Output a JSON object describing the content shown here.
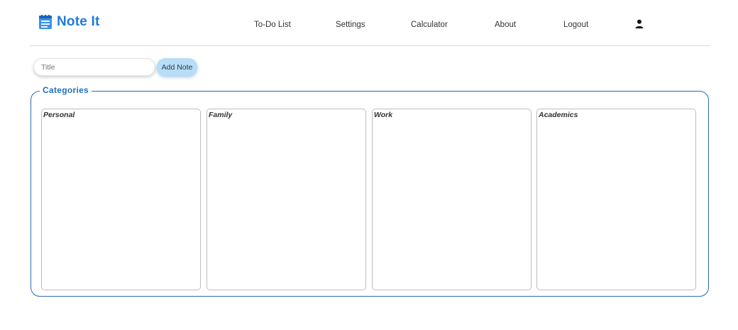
{
  "app": {
    "title": "Note It",
    "brand_icon": "notepad-icon",
    "brand_color": "#1f7bd8"
  },
  "nav": {
    "items": [
      {
        "label": "To-Do List"
      },
      {
        "label": "Settings"
      },
      {
        "label": "Calculator"
      },
      {
        "label": "About"
      },
      {
        "label": "Logout"
      }
    ],
    "user_icon": "user-icon"
  },
  "add_note": {
    "title_placeholder": "Title",
    "title_value": "",
    "button_label": "Add Note",
    "button_color": "#b8ddf6"
  },
  "categories": {
    "legend": "Categories",
    "border_color": "#2b6cb0",
    "items": [
      {
        "label": "Personal"
      },
      {
        "label": "Family"
      },
      {
        "label": "Work"
      },
      {
        "label": "Academics"
      }
    ]
  }
}
